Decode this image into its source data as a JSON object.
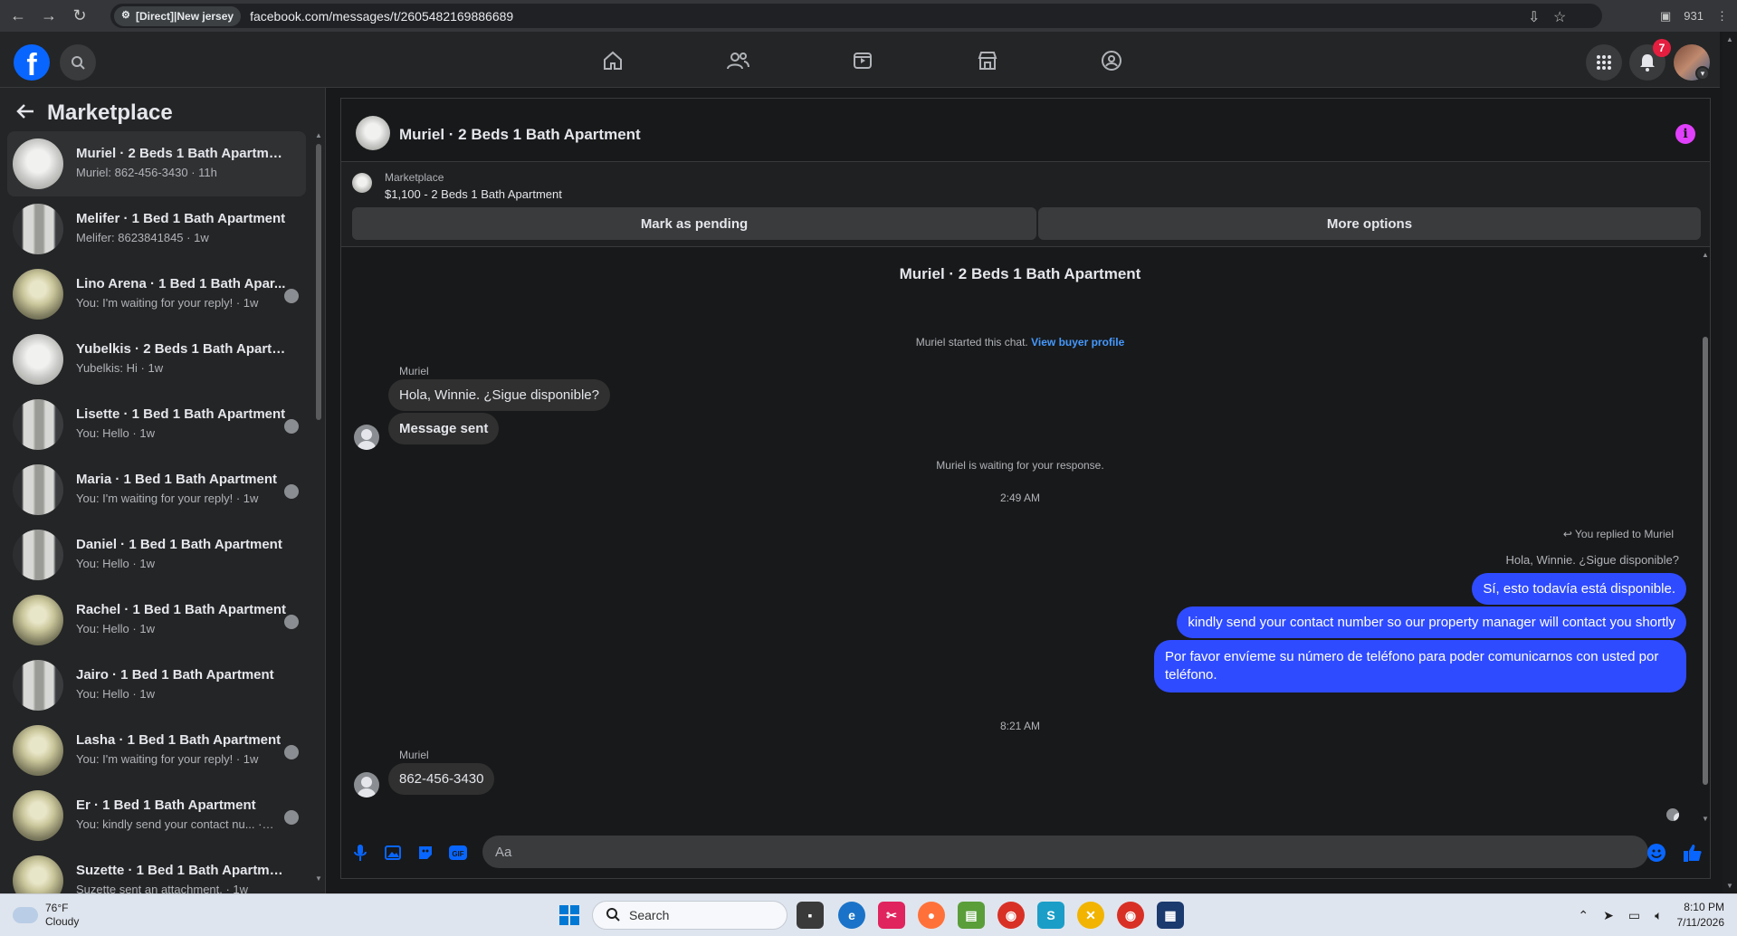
{
  "browser": {
    "proxy_label": "[Direct]|New jersey",
    "url": "facebook.com/messages/t/2605482169886689",
    "profile_counter": "931"
  },
  "header": {
    "notifications_count": "7",
    "logo_letter": "f"
  },
  "sidebar": {
    "title": "Marketplace",
    "conversations": [
      {
        "title": "Muriel · 2 Beds 1 Bath Apartment",
        "sub": "Muriel: 862-456-3430 · 11h",
        "thumb": "a"
      },
      {
        "title": "Melifer · 1 Bed 1 Bath Apartment",
        "sub": "Melifer: 8623841845 · 1w",
        "thumb": "b"
      },
      {
        "title": "Lino Arena · 1 Bed 1 Bath Apar...",
        "sub": "You: I'm waiting for your reply! · 1w",
        "thumb": "c"
      },
      {
        "title": "Yubelkis · 2 Beds 1 Bath Apartm...",
        "sub": "Yubelkis: Hi · 1w",
        "thumb": "a"
      },
      {
        "title": "Lisette · 1 Bed 1 Bath Apartment",
        "sub": "You: Hello · 1w",
        "thumb": "b"
      },
      {
        "title": "Maria · 1 Bed 1 Bath Apartment",
        "sub": "You: I'm waiting for your reply! · 1w",
        "thumb": "b"
      },
      {
        "title": "Daniel · 1 Bed 1 Bath Apartment",
        "sub": "You: Hello · 1w",
        "thumb": "b"
      },
      {
        "title": "Rachel · 1 Bed 1 Bath Apartment",
        "sub": "You: Hello · 1w",
        "thumb": "c"
      },
      {
        "title": "Jairo · 1 Bed 1 Bath Apartment",
        "sub": "You: Hello · 1w",
        "thumb": "b"
      },
      {
        "title": "Lasha · 1 Bed 1 Bath Apartment",
        "sub": "You: I'm waiting for your reply! · 1w",
        "thumb": "c"
      },
      {
        "title": "Er · 1 Bed 1 Bath Apartment",
        "sub": "You: kindly send your contact nu... · 1w",
        "thumb": "c"
      },
      {
        "title": "Suzette · 1 Bed 1 Bath Apartment",
        "sub": "Suzette sent an attachment. · 1w",
        "thumb": "c"
      }
    ]
  },
  "chat": {
    "title": "Muriel · 2 Beds 1 Bath Apartment",
    "listing_source": "Marketplace",
    "listing_price": "$1,100 - 2 Beds 1 Bath Apartment",
    "mark_pending_label": "Mark as pending",
    "more_options_label": "More options",
    "thread_title": "Muriel · 2 Beds 1 Bath Apartment",
    "started_text": "Muriel started this chat.",
    "view_profile_link": "View buyer profile",
    "sender_name": "Muriel",
    "msg_in_1": "Hola, Winnie. ¿Sigue disponible?",
    "msg_in_2": "Message sent",
    "waiting_text": "Muriel is waiting for your response.",
    "time_1": "2:49 AM",
    "replied_to": "You replied to Muriel",
    "quoted_msg": "Hola, Winnie. ¿Sigue disponible?",
    "msg_out_1": "Sí, esto todavía está disponible.",
    "msg_out_2": "kindly send your contact number so our property manager will contact you shortly",
    "msg_out_3": "Por favor envíeme su número de teléfono para poder comunicarnos con usted por teléfono.",
    "time_2": "8:21 AM",
    "sender_name_2": "Muriel",
    "msg_in_3": "862-456-3430",
    "composer_placeholder": "Aa"
  },
  "taskbar": {
    "temperature": "76°F",
    "condition": "Cloudy",
    "search_label": "Search",
    "time": "8:10 PM",
    "date": "7/11/2026"
  },
  "colors": {
    "accent": "#0866ff",
    "bubble_out": "#2f4bff",
    "info_icon": "#e040fb",
    "badge": "#e41e3f"
  }
}
